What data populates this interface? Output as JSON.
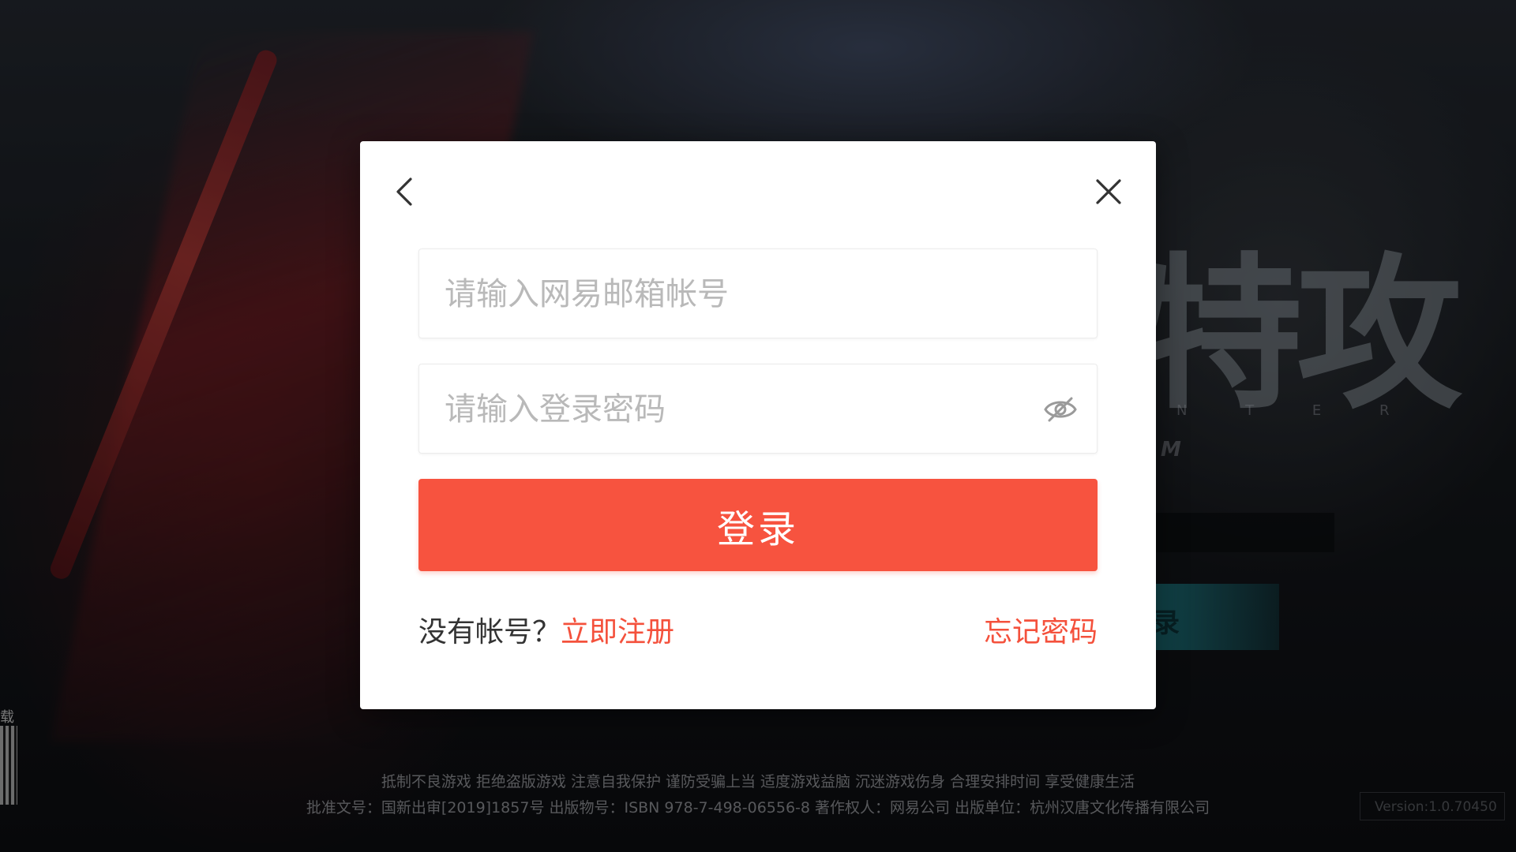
{
  "background": {
    "logo_text": "特攻",
    "logo_subtitle": "N T E R",
    "logo_fragment": "M",
    "side_button_glyph": "录",
    "qr_label": "载"
  },
  "footer": {
    "line1": "抵制不良游戏 拒绝盗版游戏 注意自我保护 谨防受骗上当 适度游戏益脑 沉迷游戏伤身 合理安排时间 享受健康生活",
    "line2": "批准文号：国新出审[2019]1857号 出版物号：ISBN 978-7-498-06556-8 著作权人：网易公司 出版单位：杭州汉唐文化传播有限公司",
    "version": "Version:1.0.70450"
  },
  "dialog": {
    "email_placeholder": "请输入网易邮箱帐号",
    "email_value": "",
    "password_placeholder": "请输入登录密码",
    "password_value": "",
    "login_label": "登录",
    "no_account_text": "没有帐号？",
    "register_label": "立即注册",
    "forgot_label": "忘记密码"
  },
  "colors": {
    "accent": "#f7533f",
    "link": "#f4513c"
  },
  "icons": {
    "back": "chevron-left-icon",
    "close": "close-icon",
    "password_visibility": "eye-off-icon"
  }
}
